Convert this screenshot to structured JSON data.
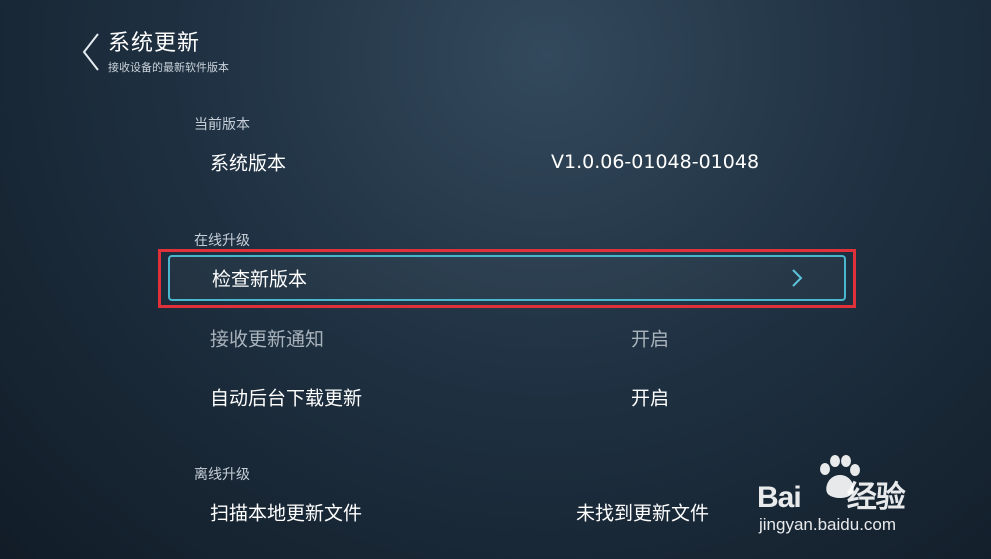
{
  "header": {
    "title": "系统更新",
    "subtitle": "接收设备的最新软件版本"
  },
  "sections": {
    "current": {
      "label": "当前版本",
      "system_version_label": "系统版本",
      "system_version_value": "V1.0.06-01048-01048"
    },
    "online": {
      "label": "在线升级",
      "check_label": "检查新版本",
      "notify_label": "接收更新通知",
      "notify_value": "开启",
      "auto_label": "自动后台下载更新",
      "auto_value": "开启"
    },
    "offline": {
      "label": "离线升级",
      "scan_label": "扫描本地更新文件",
      "scan_value": "未找到更新文件"
    }
  },
  "watermark": {
    "brand": "Bai",
    "brand_suffix": "经验",
    "url": "jingyan.baidu.com"
  },
  "colors": {
    "focus_border": "#4ab7cf",
    "annotation_box": "#e0303a"
  }
}
